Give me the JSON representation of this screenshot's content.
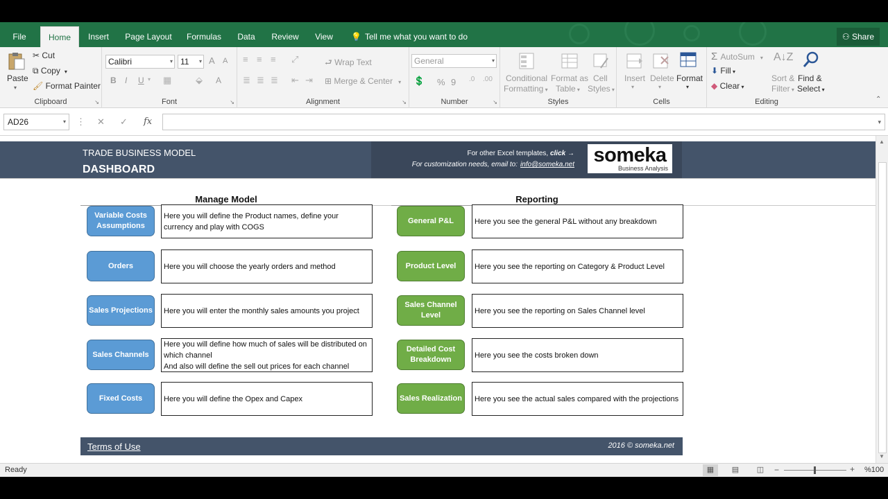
{
  "ribbon_tabs": [
    "File",
    "Home",
    "Insert",
    "Page Layout",
    "Formulas",
    "Data",
    "Review",
    "View"
  ],
  "active_tab": "Home",
  "tell_me": "Tell me what you want to do",
  "share": "Share",
  "clipboard": {
    "paste": "Paste",
    "cut": "Cut",
    "copy": "Copy",
    "format_painter": "Format Painter",
    "label": "Clipboard"
  },
  "font": {
    "name": "Calibri",
    "size": "11",
    "bold": "B",
    "italic": "I",
    "underline": "U",
    "grow": "A",
    "shrink": "A",
    "color": "A",
    "label": "Font"
  },
  "alignment": {
    "wrap_text": "Wrap Text",
    "merge_center": "Merge & Center",
    "label": "Alignment"
  },
  "number": {
    "format": "General",
    "percent": "%",
    "comma": "9",
    "label": "Number"
  },
  "styles": {
    "conditional": "Conditional",
    "conditional2": "Formatting",
    "format_as": "Format as",
    "table": "Table",
    "cell": "Cell",
    "styles": "Styles",
    "label": "Styles"
  },
  "cells": {
    "insert": "Insert",
    "delete": "Delete",
    "format": "Format",
    "label": "Cells"
  },
  "editing": {
    "autosum": "AutoSum",
    "fill": "Fill",
    "clear": "Clear",
    "sort": "Sort &",
    "filter": "Filter",
    "find": "Find &",
    "select": "Select",
    "label": "Editing"
  },
  "formula_bar": {
    "name_box": "AD26",
    "fx": "fx",
    "value": ""
  },
  "dashboard": {
    "model_label": "TRADE BUSINESS MODEL",
    "title": "DASHBOARD",
    "promo_line1": "For other Excel templates,",
    "promo_click": "click →",
    "promo_line2": "For customization needs, email to:",
    "promo_email": "info@someka.net",
    "logo_word": "someka",
    "logo_sub": "Business Analysis",
    "manage_title": "Manage Model",
    "reporting_title": "Reporting",
    "manage_items": [
      {
        "button": "Variable Costs Assumptions",
        "desc": "Here you will define the Product names, define your currency and play with COGS"
      },
      {
        "button": "Orders",
        "desc": "Here you will choose the yearly orders and method"
      },
      {
        "button": "Sales Projections",
        "desc": "Here you will enter the monthly sales amounts you project"
      },
      {
        "button": "Sales Channels",
        "desc": "Here you will define how much of sales will be distributed on which channel\nAnd also will define the sell out prices for each channel"
      },
      {
        "button": "Fixed Costs",
        "desc": "Here you will define the Opex and Capex"
      }
    ],
    "report_items": [
      {
        "button": "General P&L",
        "desc": "Here you see the general P&L without any breakdown"
      },
      {
        "button": "Product Level",
        "desc": "Here you see the reporting on Category & Product Level"
      },
      {
        "button": "Sales Channel Level",
        "desc": "Here you see the reporting on Sales Channel level"
      },
      {
        "button": "Detailed Cost Breakdown",
        "desc": "Here you see the costs broken down"
      },
      {
        "button": "Sales Realization",
        "desc": "Here you see the actual sales compared with the projections"
      }
    ],
    "terms": "Terms of Use",
    "copyright": "2016 © someka.net"
  },
  "status": {
    "ready": "Ready",
    "zoom": "%100"
  },
  "colors": {
    "excel_green": "#217346",
    "header_slate": "#44546a",
    "blue_button": "#5b9bd5",
    "green_button": "#70ad47"
  }
}
